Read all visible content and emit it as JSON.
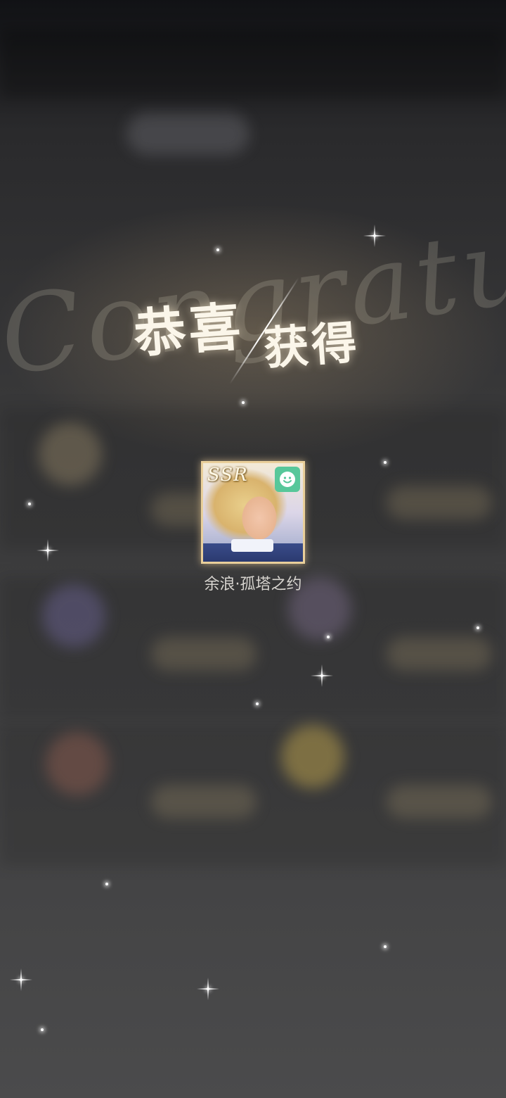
{
  "title": {
    "main": "恭喜",
    "sub": "获得",
    "script_bg": "Congratulation"
  },
  "reward": {
    "rarity": "SSR",
    "name": "余浪·孤塔之约",
    "badge_icon": "smiley-icon"
  },
  "colors": {
    "card_border": "#e9cf9a",
    "badge_bg": "#57c79a",
    "title_text": "#fbf6ea"
  }
}
